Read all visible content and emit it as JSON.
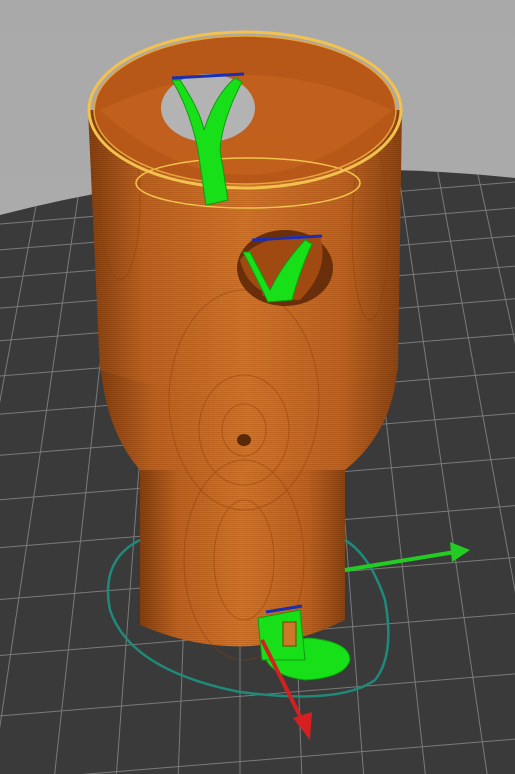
{
  "viewport": {
    "view": "3d-preview",
    "colors": {
      "background_top": "#a9a9a9",
      "background_bottom": "#b2b2b2",
      "bed_plate": "#3a3a3a",
      "bed_grid": "#777777",
      "model_wall": "#cc6a1f",
      "model_wall_dark": "#8a3f0c",
      "model_rim": "#f2c14e",
      "support": "#18e018",
      "support_dark": "#0f9a10",
      "axis_x": "#22cc22",
      "axis_y": "#d42020",
      "rotation_ring": "#1f8a7a"
    },
    "gizmo": {
      "icons": [
        "x-axis-arrow-icon",
        "y-axis-arrow-icon",
        "rotation-ring-icon"
      ]
    }
  }
}
